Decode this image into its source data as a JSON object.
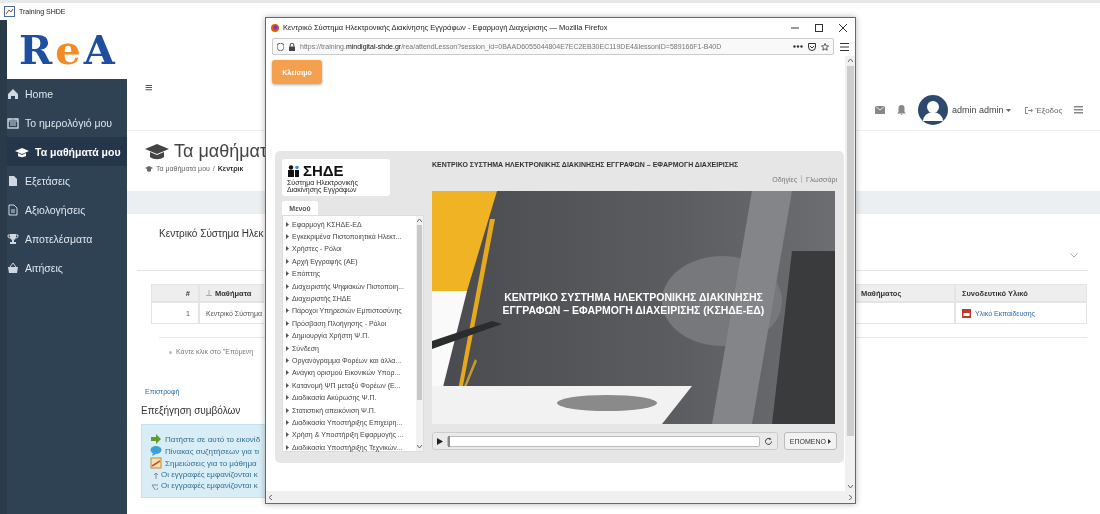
{
  "app_window": {
    "title": "Training SHDE"
  },
  "logo": {
    "letters": [
      {
        "text": "R",
        "color": "#1d4f9e"
      },
      {
        "text": "e",
        "color": "#f28a26"
      },
      {
        "text": "A",
        "color": "#1d4f9e"
      }
    ]
  },
  "sidebar": {
    "items": [
      {
        "label": "Home",
        "selected": false
      },
      {
        "label": "Το ημερολόγιό μου",
        "selected": false
      },
      {
        "label": "Τα μαθήματά μου",
        "selected": true
      },
      {
        "label": "Εξετάσεις",
        "selected": false
      },
      {
        "label": "Αξιολογήσεις",
        "selected": false
      },
      {
        "label": "Αποτελέσματα",
        "selected": false
      },
      {
        "label": "Αιτήσεις",
        "selected": false
      }
    ]
  },
  "header": {
    "menu_toggle": "≡",
    "user": "admin admin",
    "logout": "Έξοδος"
  },
  "page": {
    "title": "Τα μαθήματ",
    "breadcrumb": [
      {
        "text": "Τα μαθήματά μου",
        "kind": "link"
      },
      {
        "text": "/",
        "kind": "separator"
      },
      {
        "text": "Κεντρικ",
        "kind": "current"
      }
    ],
    "course_title": "Κεντρικό Σύστημα Ηλεκ"
  },
  "table": {
    "columns": [
      "#",
      "Μαθήματα",
      "Μαθήματος",
      "Συνοδευτικό Υλικό"
    ],
    "rows": [
      {
        "number": "1",
        "course": "Κεντρικό Σύστημα",
        "material": "Υλικό Εκπαίδευσης"
      }
    ]
  },
  "hint": "Κάντε κλικ στο \"Επόμενη",
  "back_link": "Επιστροφή",
  "legend": {
    "title": "Επεξήγηση συμβόλων",
    "items": [
      "Πατήστε σε αυτό το εικονίδ",
      "Πίνακας συζητήσεων για τι",
      "Σημειώσεις για το μάθημα",
      "Οι εγγραφές εμφανίζονται κ",
      "Οι εγγραφές εμφανίζονται κ"
    ]
  },
  "popup": {
    "title": "Κεντρικό Σύστημα Ηλεκτρονικής Διακίνησης Εγγράφων - Εφαρμογή Διαχείρισης — Mozilla Firefox",
    "url": [
      {
        "text": "https://training.",
        "kind": "dim"
      },
      {
        "text": "mindigital-shde.gr",
        "kind": "host"
      },
      {
        "text": "/rea/attendLesson?session_id=0BAAD6055044804E7EC2EB30EC119DE4&lessonID=589166F1-B40D",
        "kind": "dim"
      }
    ],
    "close_button": "Κλείσιμο",
    "player": {
      "logo_title": "ΣΗΔΕ",
      "logo_subtitle": "Σύστημα Ηλεκτρονικής Διακίνησης Εγγράφων",
      "menu_tab": "Μενού",
      "menu_items": [
        "Εφαρμογή ΚΣΗΔΕ-ΕΔ",
        "Εγκεκριμένα Πιστοποιητικά Ηλεκτ...",
        "Χρήστες - Ρόλοι",
        "Αρχή Εγγραφής (ΑΕ)",
        "Επόπτης",
        "Διαχειριστής Ψηφιακών Πιστοποιη...",
        "Διαχειριστής ΣΗΔΕ",
        "Πάροχοι Υπηρεσιών Εμπιστοσύνης",
        "Πρόσβαση Πλοήγησης - Ρόλοι",
        "Δημιουργία Χρήστη Ψ.Π.",
        "Σύνδεση",
        "Οργανόγραμμα Φορέων και άλλα...",
        "Ανάγκη ορισμού Εικονικών Υπορ...",
        "Κατανομή ΨΠ μεταξύ Φορέων (Ε...",
        "Διαδικασία Ακύρωσης Ψ.Π.",
        "Στατιστική απεικόνιση Ψ.Π.",
        "Διαδικασία Υποστήριξης Επιχειρη...",
        "Χρήση & Υποστήριξη Εφαρμογής ...",
        "Διαδικασία Υποστήριξης Τεχνικών..."
      ],
      "header": "ΚΕΝΤΡΙΚΟ ΣΥΣΤΗΜΑ ΗΛΕΚΤΡΟΝΙΚΗΣ ΔΙΑΚΙΝΗΣΗΣ ΕΓΓΡΑΦΩΝ – ΕΦΑΡΜΟΓΗ ΔΙΑΧΕΙΡΙΣΗΣ",
      "links": [
        "Οδηγίες",
        "Γλωσσάρι"
      ],
      "slide_title_lines": [
        "ΚΕΝΤΡΙΚΟ ΣΥΣΤΗΜΑ ΗΛΕΚΤΡΟΝΙΚΗΣ ΔΙΑΚΙΝΗΣΗΣ",
        "ΕΓΓΡΑΦΩΝ – ΕΦΑΡΜΟΓΗ ΔΙΑΧΕΙΡΙΣΗΣ (ΚΣΗΔΕ-ΕΔ)"
      ],
      "progress": {
        "level": 0
      },
      "next_button": "ΕΠΟΜΕΝΟ"
    }
  }
}
